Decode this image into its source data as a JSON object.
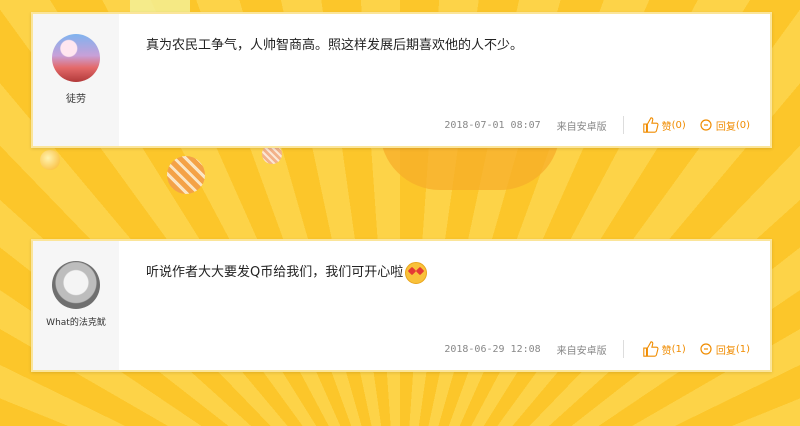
{
  "comments": [
    {
      "username": "徒劳",
      "text": "真为农民工争气，人帅智商高。照这样发展后期喜欢他的人不少。",
      "time": "2018-07-01 08:07",
      "source": "来自安卓版",
      "like_label": "赞",
      "like_count": "(0)",
      "reply_label": "回复",
      "reply_count": "(0)"
    },
    {
      "username": "What的法克鱿",
      "text": "听说作者大大要发Q币给我们，我们可开心啦",
      "time": "2018-06-29 12:08",
      "source": "来自安卓版",
      "like_label": "赞",
      "like_count": "(1)",
      "reply_label": "回复",
      "reply_count": "(1)"
    }
  ],
  "colors": {
    "accent": "#f08c00",
    "background": "#fcc62a"
  },
  "icons": [
    "thumbs-up-icon",
    "reply-icon",
    "heart-eyes-emoji"
  ]
}
